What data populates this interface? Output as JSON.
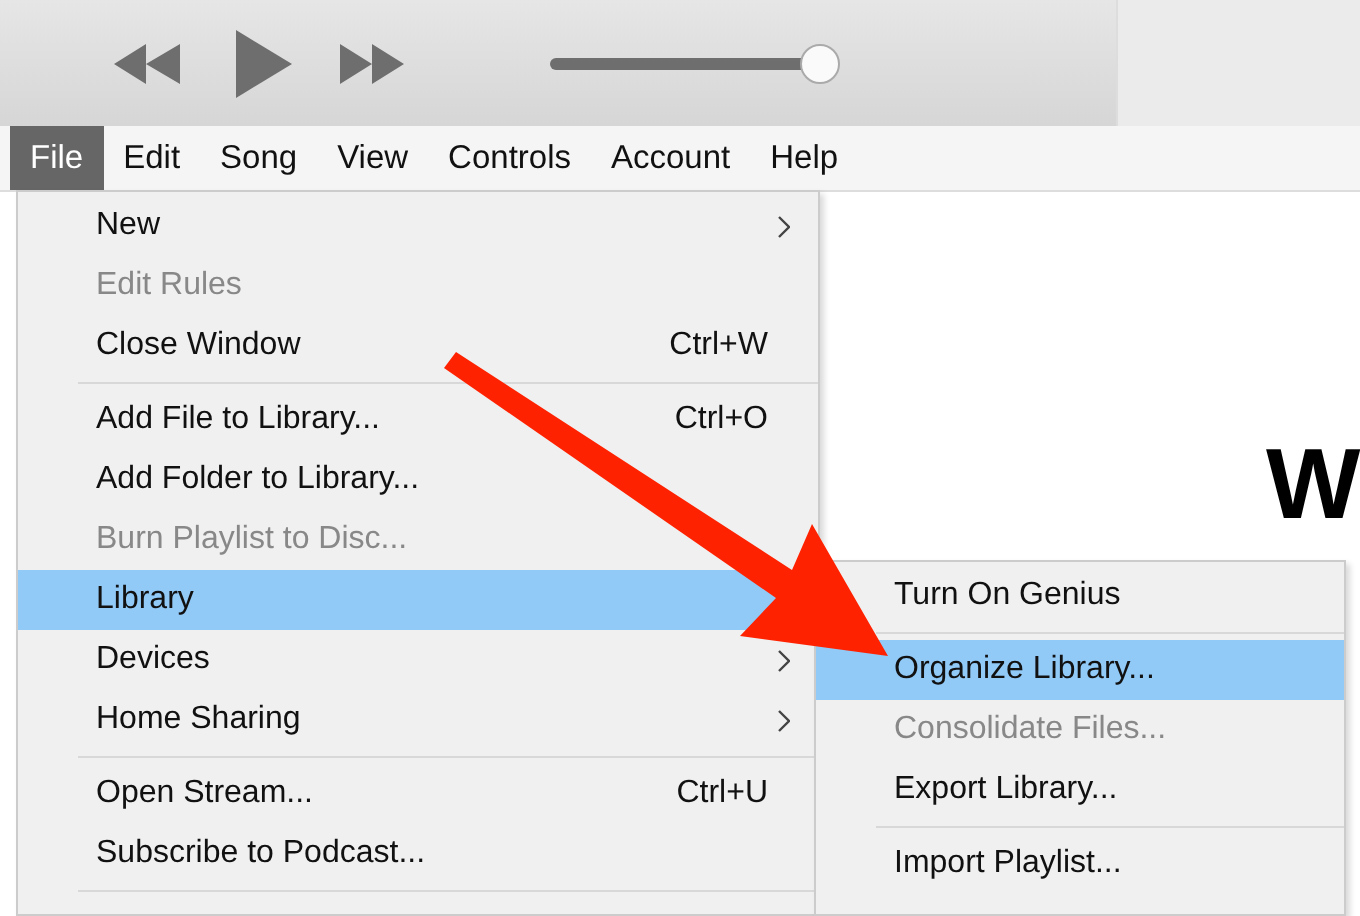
{
  "player": {
    "volume": {
      "level": 1
    }
  },
  "menubar": [
    {
      "label": "File",
      "selected": true
    },
    {
      "label": "Edit",
      "selected": false
    },
    {
      "label": "Song",
      "selected": false
    },
    {
      "label": "View",
      "selected": false
    },
    {
      "label": "Controls",
      "selected": false
    },
    {
      "label": "Account",
      "selected": false
    },
    {
      "label": "Help",
      "selected": false
    }
  ],
  "content": {
    "heading": "W"
  },
  "file_menu": [
    {
      "kind": "item",
      "label": "New",
      "submenu": true,
      "disabled": false,
      "selected": false
    },
    {
      "kind": "item",
      "label": "Edit Rules",
      "disabled": true,
      "selected": false
    },
    {
      "kind": "item",
      "label": "Close Window",
      "shortcut": "Ctrl+W",
      "disabled": false,
      "selected": false
    },
    {
      "kind": "separator"
    },
    {
      "kind": "item",
      "label": "Add File to Library...",
      "shortcut": "Ctrl+O",
      "disabled": false,
      "selected": false
    },
    {
      "kind": "item",
      "label": "Add Folder to Library...",
      "disabled": false,
      "selected": false
    },
    {
      "kind": "item",
      "label": "Burn Playlist to Disc...",
      "disabled": true,
      "selected": false
    },
    {
      "kind": "item",
      "label": "Library",
      "disabled": false,
      "selected": true
    },
    {
      "kind": "item",
      "label": "Devices",
      "submenu": true,
      "disabled": false,
      "selected": false
    },
    {
      "kind": "item",
      "label": "Home Sharing",
      "submenu": true,
      "disabled": false,
      "selected": false
    },
    {
      "kind": "separator"
    },
    {
      "kind": "item",
      "label": "Open Stream...",
      "shortcut": "Ctrl+U",
      "disabled": false,
      "selected": false
    },
    {
      "kind": "item",
      "label": "Subscribe to Podcast...",
      "disabled": false,
      "selected": false
    },
    {
      "kind": "separator"
    }
  ],
  "library_submenu": [
    {
      "kind": "item",
      "label": "Turn On Genius",
      "disabled": false,
      "selected": false
    },
    {
      "kind": "separator"
    },
    {
      "kind": "item",
      "label": "Organize Library...",
      "disabled": false,
      "selected": true
    },
    {
      "kind": "item",
      "label": "Consolidate Files...",
      "disabled": true,
      "selected": false
    },
    {
      "kind": "item",
      "label": "Export Library...",
      "disabled": false,
      "selected": false
    },
    {
      "kind": "separator"
    },
    {
      "kind": "item",
      "label": "Import Playlist...",
      "disabled": false,
      "selected": false
    }
  ]
}
